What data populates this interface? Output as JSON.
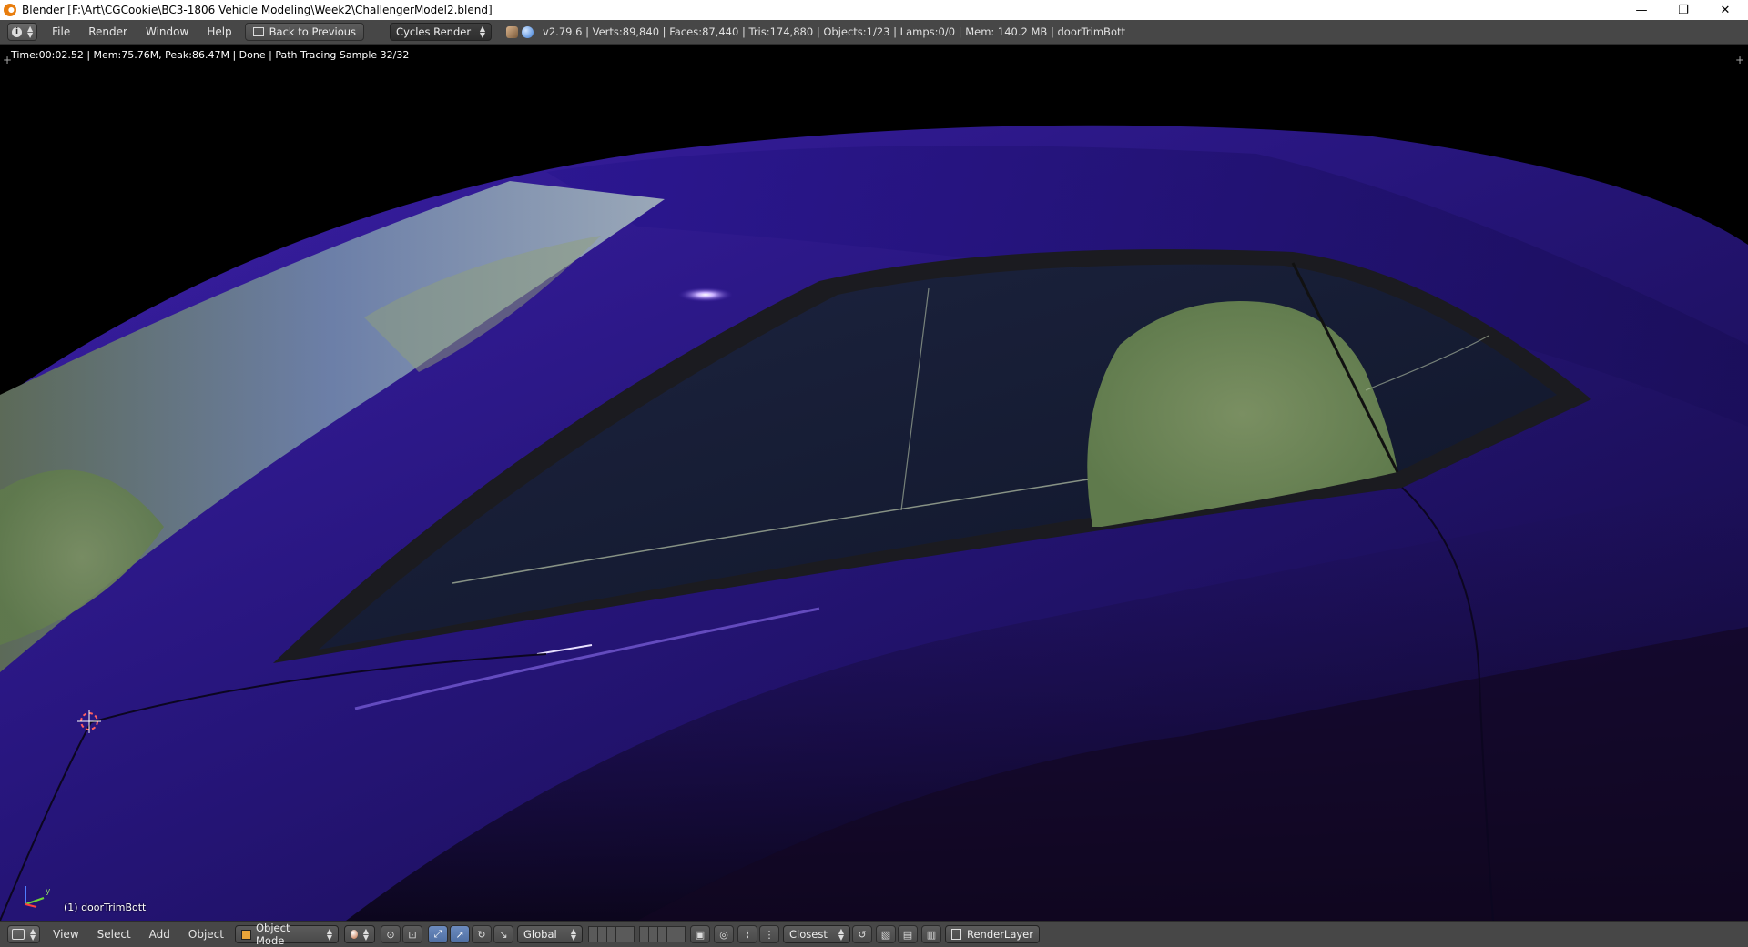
{
  "window": {
    "title": "Blender [F:\\Art\\CGCookie\\BC3-1806 Vehicle Modeling\\Week2\\ChallengerModel2.blend]",
    "minimize": "—",
    "restore": "❐",
    "close": "✕"
  },
  "info_header": {
    "menus": [
      "File",
      "Render",
      "Window",
      "Help"
    ],
    "back_button": "Back to Previous",
    "render_engine": "Cycles Render",
    "stats": "v2.79.6 | Verts:89,840 | Faces:87,440 | Tris:174,880 | Objects:1/23 | Lamps:0/0 | Mem: 140.2 MB | doorTrimBott"
  },
  "viewport": {
    "render_status": "Time:00:02.52 | Mem:75.76M, Peak:86.47M | Done | Path Tracing Sample 32/32",
    "object_label": "(1) doorTrimBott",
    "axis_y": "y"
  },
  "bottom_header": {
    "menus": [
      "View",
      "Select",
      "Add",
      "Object"
    ],
    "mode": "Object Mode",
    "orientation": "Global",
    "snap_target": "Closest",
    "render_layer": "RenderLayer"
  },
  "colors": {
    "header_bg": "#474747",
    "car_paint": "#2a1a7a",
    "active_blue": "#5680c2"
  }
}
